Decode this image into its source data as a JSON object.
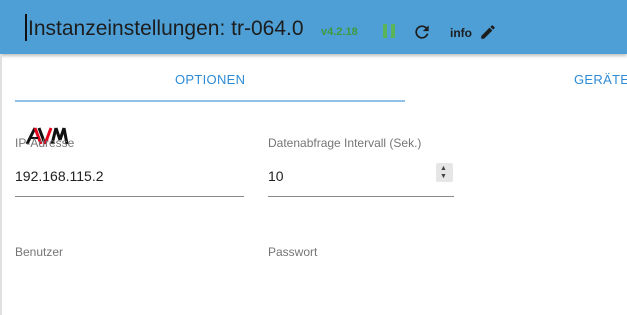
{
  "header": {
    "title": "Instanzeinstellungen: tr-064.0",
    "version": "v4.2.18",
    "info_label": "info",
    "colors": {
      "bar": "#4e9fd6",
      "version": "#3f9a3f",
      "pause": "#5ab55a"
    },
    "icons": [
      "pause-icon",
      "refresh-icon",
      "edit-icon"
    ]
  },
  "tabs": [
    {
      "label": "OPTIONEN",
      "active": true
    },
    {
      "label": "GERÄTE",
      "active": false
    }
  ],
  "logo": {
    "icon": "avm-logo"
  },
  "fields": {
    "ip": {
      "label": "IP-Adresse",
      "value": "192.168.115.2"
    },
    "interval": {
      "label": "Datenabfrage Intervall (Sek.)",
      "value": "10"
    },
    "user": {
      "label": "Benutzer"
    },
    "password": {
      "label": "Passwort"
    }
  }
}
